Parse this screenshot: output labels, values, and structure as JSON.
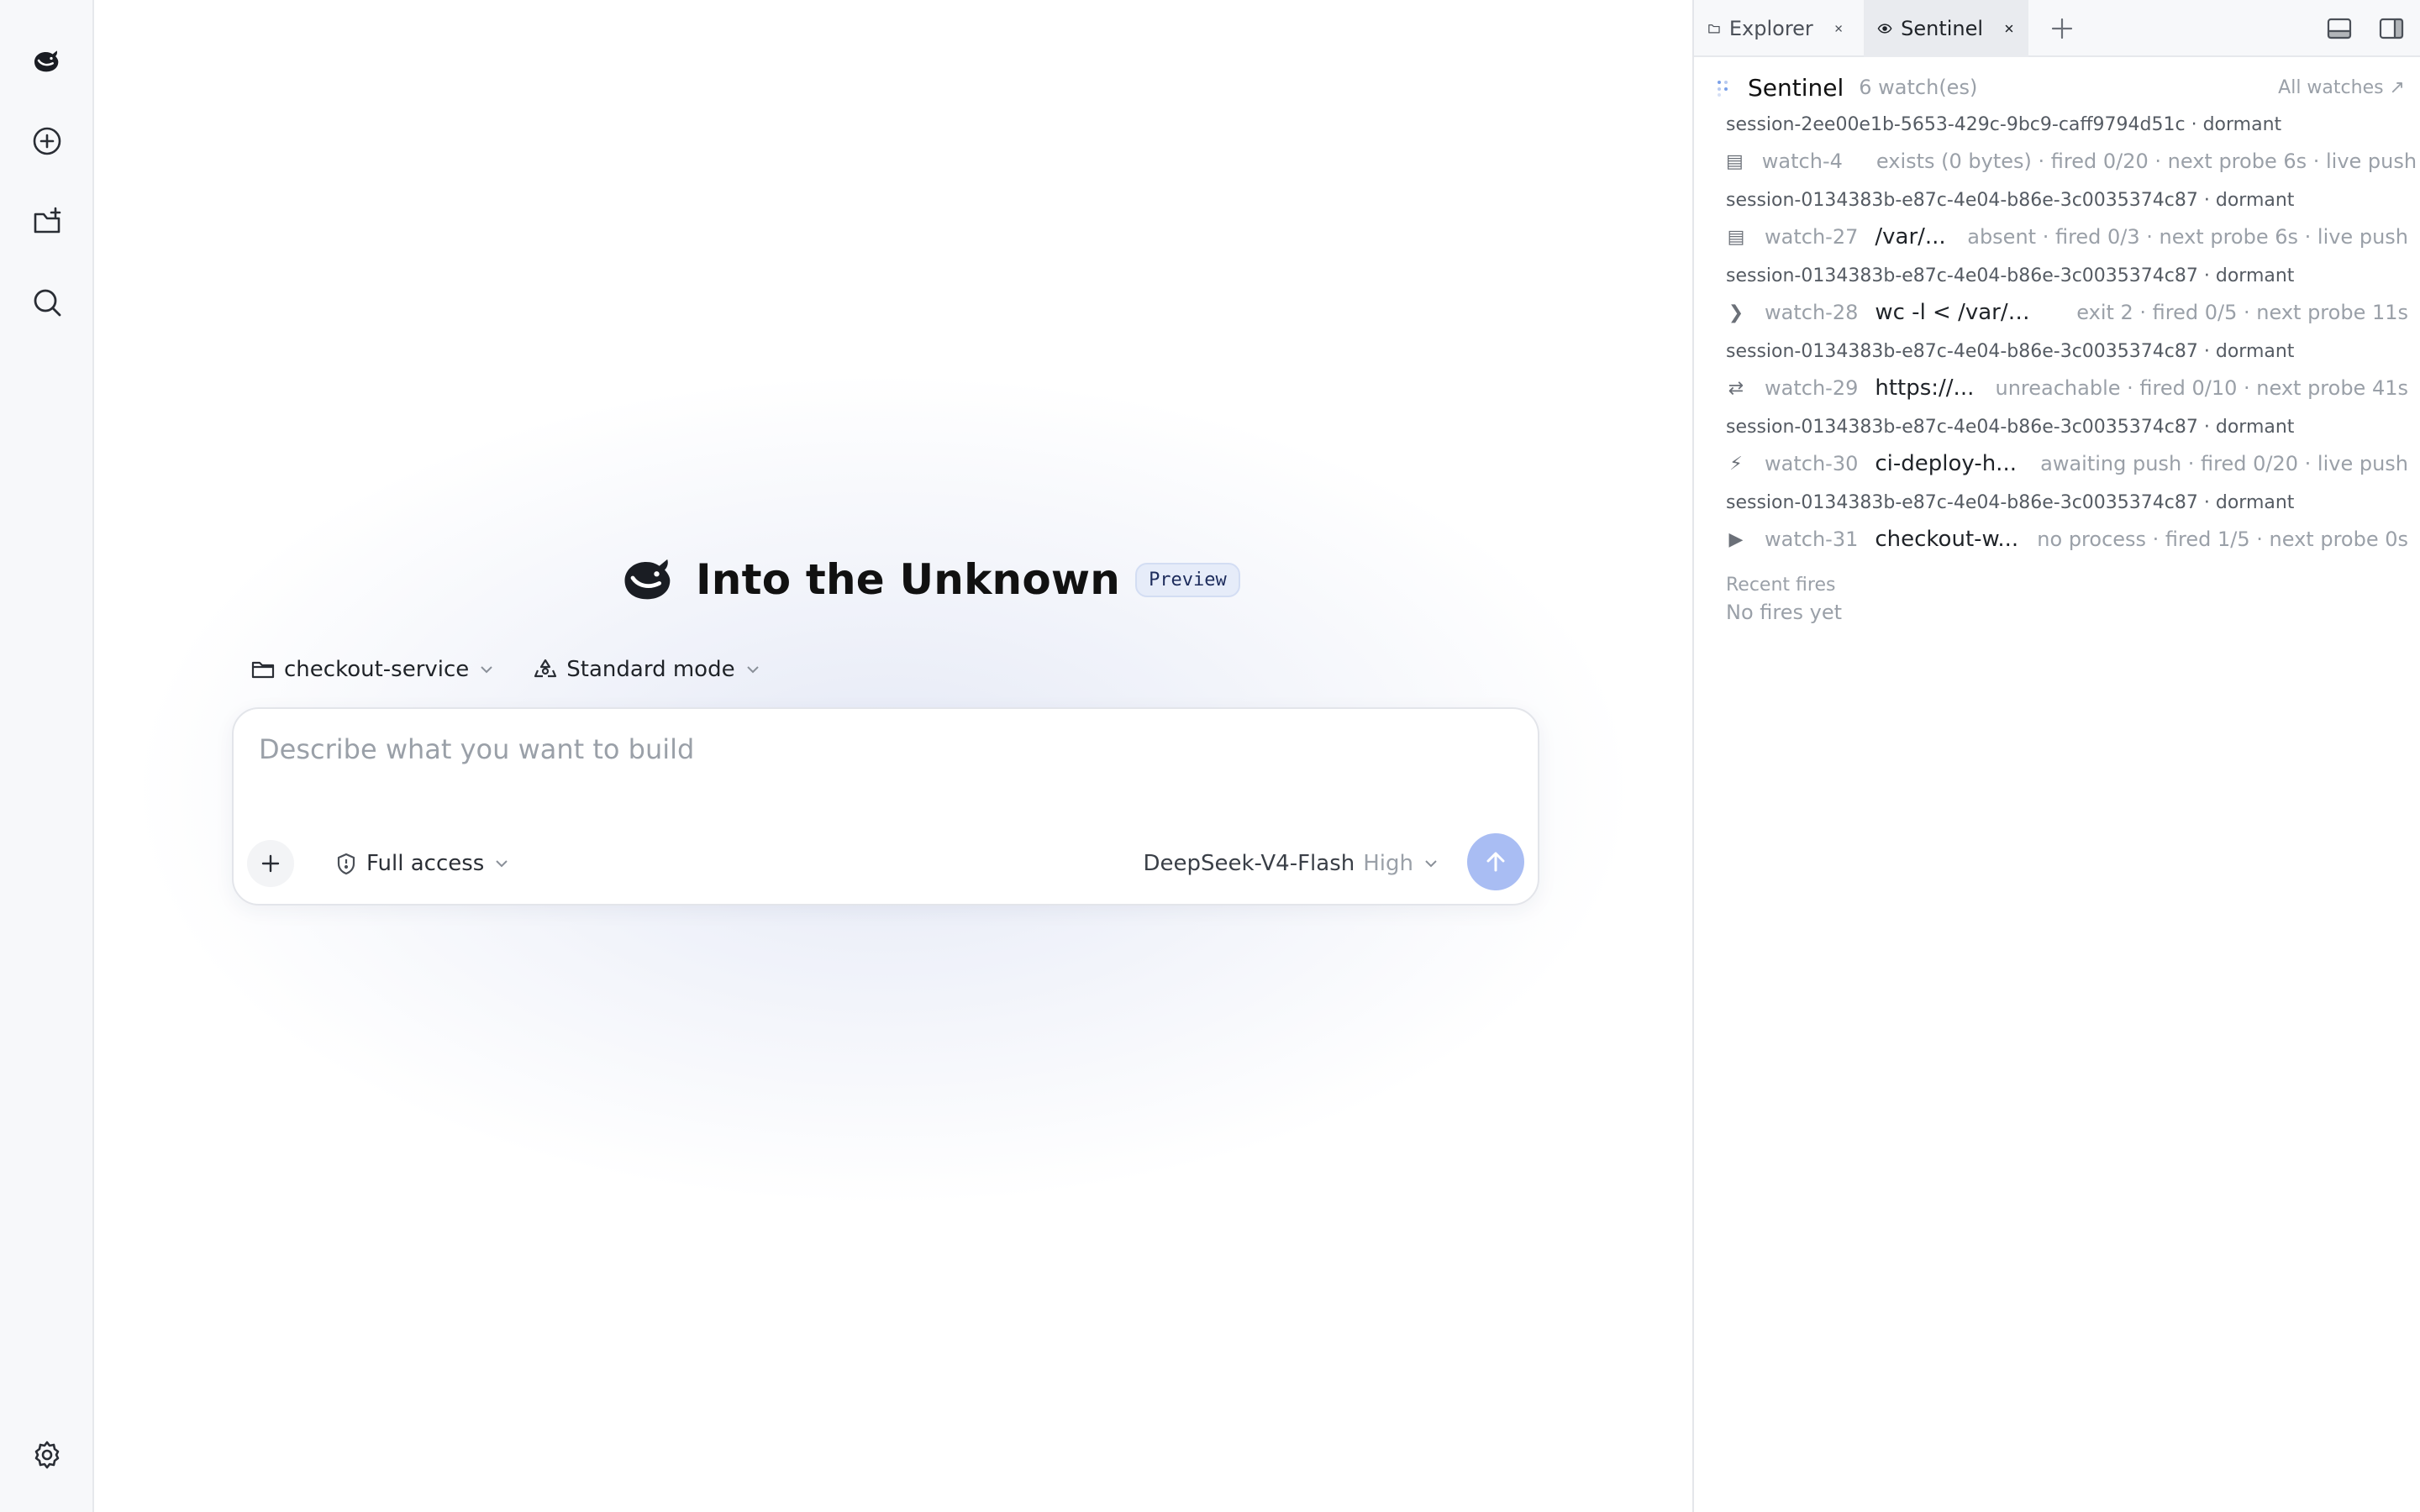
{
  "rail": {
    "logo": "deepseek-whale-icon",
    "items": [
      "new-chat-icon",
      "new-project-icon",
      "search-icon"
    ],
    "bottom": "gear-icon"
  },
  "hero": {
    "title": "Into the Unknown",
    "badge": "Preview"
  },
  "selectors": {
    "project": "checkout-service",
    "mode": "Standard mode"
  },
  "composer": {
    "placeholder": "Describe what you want to build",
    "access": "Full access",
    "model": "DeepSeek-V4-Flash",
    "effort": "High"
  },
  "panel": {
    "tabs": [
      {
        "label": "Explorer",
        "icon": "folder-icon",
        "active": false
      },
      {
        "label": "Sentinel",
        "icon": "eye-icon",
        "active": true
      }
    ],
    "header": {
      "title": "Sentinel",
      "count": "6 watch(es)",
      "link": "All watches ↗"
    },
    "watches": [
      {
        "session": "session-2ee00e1b-5653-429c-9bc9-caff9794d51c · dormant",
        "kind": "▤",
        "id": "watch-4",
        "target": "",
        "status": "exists (0 bytes) · fired 0/20 · next probe 6s · live push"
      },
      {
        "session": "session-0134383b-e87c-4e04-b86e-3c0035374c87 · dormant",
        "kind": "▤",
        "id": "watch-27",
        "target": "/var/...",
        "status": "absent · fired 0/3 · next probe 6s · live push"
      },
      {
        "session": "session-0134383b-e87c-4e04-b86e-3c0035374c87 · dormant",
        "kind": "❯",
        "id": "watch-28",
        "target": "wc -l < /var/lo...",
        "status": "exit 2 · fired 0/5 · next probe 11s"
      },
      {
        "session": "session-0134383b-e87c-4e04-b86e-3c0035374c87 · dormant",
        "kind": "⇄",
        "id": "watch-29",
        "target": "https://...",
        "status": "unreachable · fired 0/10 · next probe 41s"
      },
      {
        "session": "session-0134383b-e87c-4e04-b86e-3c0035374c87 · dormant",
        "kind": "⚡",
        "id": "watch-30",
        "target": "ci-deploy-h...",
        "status": "awaiting push · fired 0/20 · live push"
      },
      {
        "session": "session-0134383b-e87c-4e04-b86e-3c0035374c87 · dormant",
        "kind": "▶",
        "id": "watch-31",
        "target": "checkout-w...",
        "status": "no process · fired 1/5 · next probe 0s"
      }
    ],
    "recent": {
      "title": "Recent fires",
      "empty": "No fires yet"
    }
  }
}
